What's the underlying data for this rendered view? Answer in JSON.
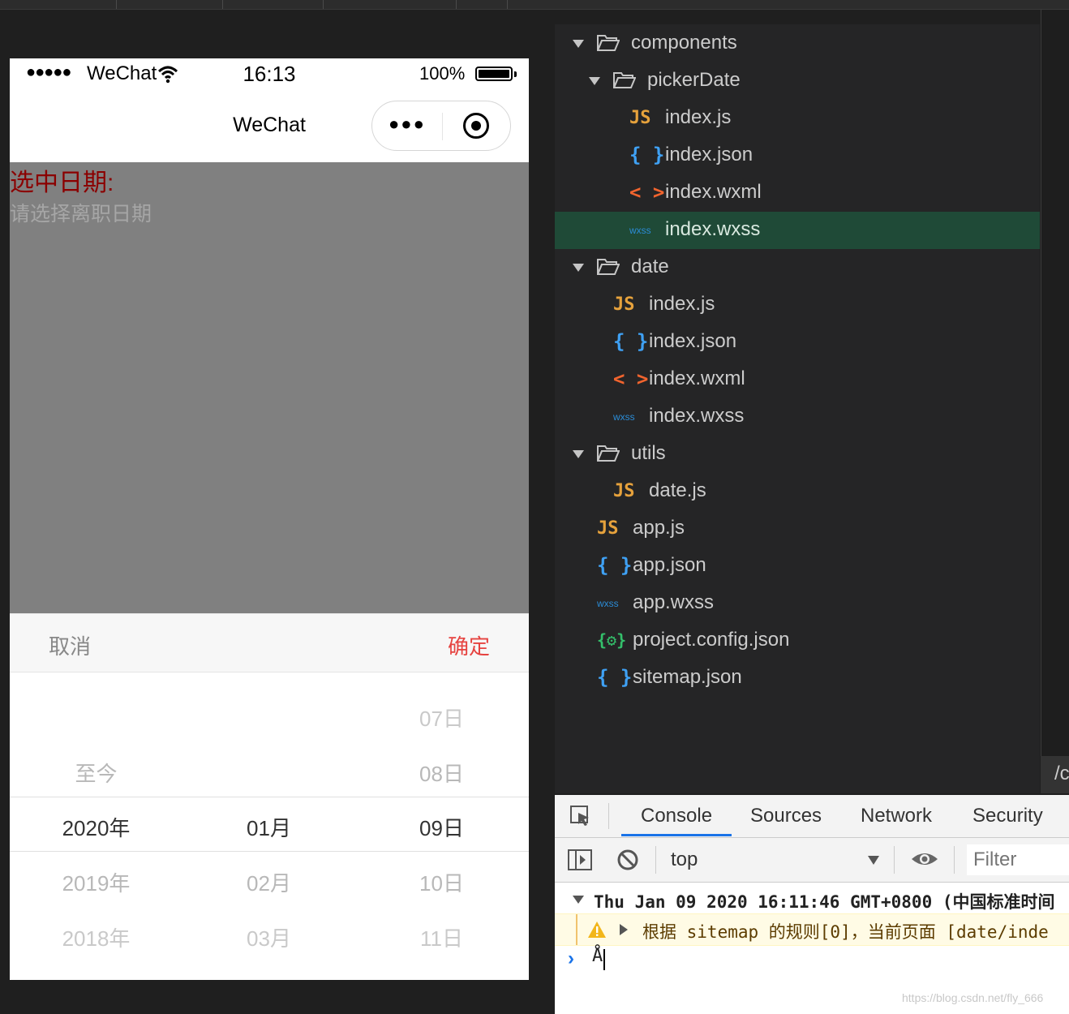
{
  "simulator": {
    "status": {
      "signal": "●●●●●",
      "carrier": "WeChat",
      "time": "16:13",
      "battery": "100%"
    },
    "nav": {
      "title": "WeChat",
      "more_icon": "more-dots-icon",
      "close_icon": "close-capsule-icon"
    },
    "page": {
      "selected_label": "选中日期:",
      "placeholder": "请选择离职日期",
      "bg_color": "#808080",
      "label_color": "#8b0000"
    },
    "picker": {
      "cancel": "取消",
      "confirm": "确定",
      "confirm_color": "#e64340",
      "years": [
        "至今",
        "2020年",
        "2019年",
        "2018年"
      ],
      "months": [
        "01月",
        "02月",
        "03月"
      ],
      "days": [
        "07日",
        "08日",
        "09日",
        "10日",
        "11日"
      ]
    }
  },
  "file_tree": {
    "selected_color": "#1f4a37",
    "items": [
      {
        "name": "components",
        "type": "folder",
        "depth": 0
      },
      {
        "name": "pickerDate",
        "type": "folder",
        "depth": 1
      },
      {
        "name": "index.js",
        "type": "js",
        "depth": 2,
        "icon": "JS"
      },
      {
        "name": "index.json",
        "type": "json",
        "depth": 2,
        "icon": "{ }"
      },
      {
        "name": "index.wxml",
        "type": "wxml",
        "depth": 2,
        "icon": "< >"
      },
      {
        "name": "index.wxss",
        "type": "wxss",
        "depth": 2,
        "icon": "wxss",
        "selected": true
      },
      {
        "name": "date",
        "type": "folder",
        "depth": 0
      },
      {
        "name": "index.js",
        "type": "js",
        "depth": 1,
        "icon": "JS"
      },
      {
        "name": "index.json",
        "type": "json",
        "depth": 1,
        "icon": "{ }"
      },
      {
        "name": "index.wxml",
        "type": "wxml",
        "depth": 1,
        "icon": "< >"
      },
      {
        "name": "index.wxss",
        "type": "wxss",
        "depth": 1,
        "icon": "wxss"
      },
      {
        "name": "utils",
        "type": "folder",
        "depth": 0
      },
      {
        "name": "date.js",
        "type": "js",
        "depth": 1,
        "icon": "JS"
      },
      {
        "name": "app.js",
        "type": "js",
        "depth": 0,
        "icon": "JS"
      },
      {
        "name": "app.json",
        "type": "json",
        "depth": 0,
        "icon": "{ }"
      },
      {
        "name": "app.wxss",
        "type": "wxss",
        "depth": 0,
        "icon": "wxss"
      },
      {
        "name": "project.config.json",
        "type": "cfg",
        "depth": 0,
        "icon": "{⚙}"
      },
      {
        "name": "sitemap.json",
        "type": "json",
        "depth": 0,
        "icon": "{ }"
      }
    ],
    "right_strip_text": "/c"
  },
  "devtools": {
    "tabs": [
      "Console",
      "Sources",
      "Network",
      "Security"
    ],
    "active_tab": "Console",
    "context": "top",
    "filter_placeholder": "Filter",
    "log": "Thu Jan 09 2020 16:11:46 GMT+0800 (中国标准时间",
    "warning": "根据 sitemap 的规则[0]，当前页面 [date/inde",
    "prompt_input": "Å",
    "accent": "#1a73e8"
  },
  "watermark": "https://blog.csdn.net/fly_666"
}
